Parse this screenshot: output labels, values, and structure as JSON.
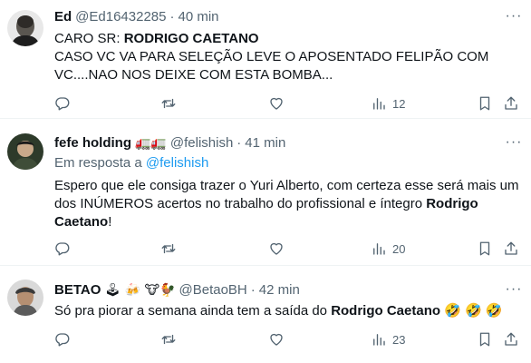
{
  "tweets": [
    {
      "name": "Ed",
      "name_emojis": "",
      "handle": "@Ed16432285",
      "dot": "·",
      "time": "40 min",
      "replying_label": "",
      "replying_handle": "",
      "text_parts": [
        "CARO SR: ",
        "RODRIGO CAETANO",
        "CASO VC VA PARA SELEÇÃO LEVE O APOSENTADO FELIPÃO COM VC....NAO NOS DEIXE COM ESTA BOMBA..."
      ],
      "views": "12"
    },
    {
      "name": "fefe holding",
      "name_emojis": "🚛🚛",
      "handle": "@felishish",
      "dot": "·",
      "time": "41 min",
      "replying_label": "Em resposta a ",
      "replying_handle": "@felishish",
      "text_parts": [
        "Espero que ele consiga trazer o Yuri Alberto, com certeza esse será mais um dos INÚMEROS acertos no trabalho do profissional e íntegro ",
        "Rodrigo Caetano",
        "!"
      ],
      "views": "20"
    },
    {
      "name": "BETAO",
      "name_emojis": "🕹 🍻 🐮🐓",
      "handle": "@BetaoBH",
      "dot": "·",
      "time": "42 min",
      "replying_label": "",
      "replying_handle": "",
      "text_parts": [
        "Só pra piorar a semana ainda tem a saída do ",
        "Rodrigo Caetano",
        " 🤣 🤣 🤣"
      ],
      "views": "23"
    }
  ],
  "more_label": "···",
  "icons": [
    "reply-icon",
    "retweet-icon",
    "like-icon",
    "views-icon",
    "bookmark-icon",
    "share-icon"
  ],
  "colors": {
    "text": "#0f1419",
    "secondary": "#536471",
    "link": "#1d9bf0",
    "divider": "#eff3f4"
  }
}
